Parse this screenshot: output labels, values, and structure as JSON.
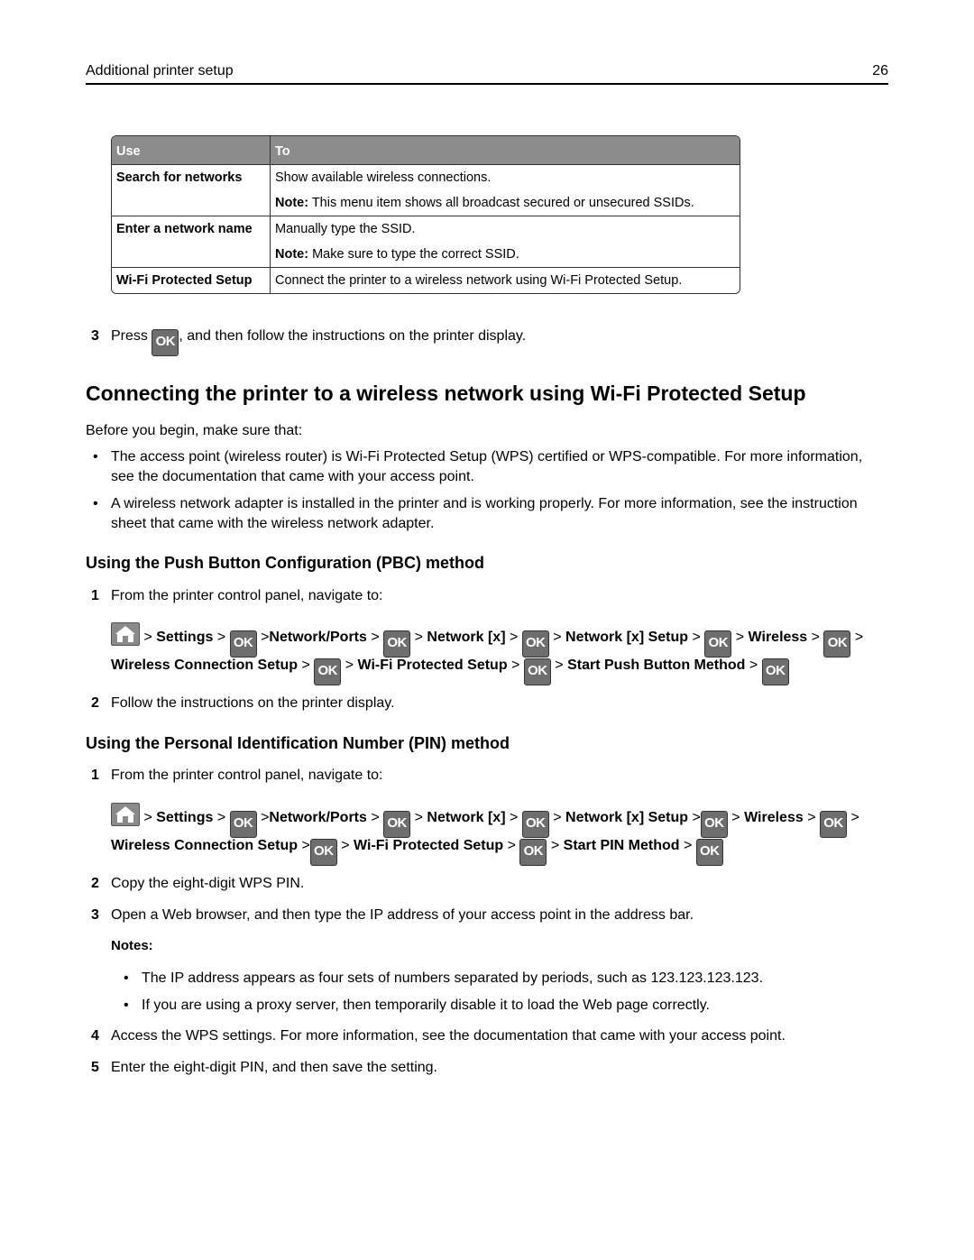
{
  "header": {
    "section": "Additional printer setup",
    "page_number": "26"
  },
  "table": {
    "columns": [
      "Use",
      "To"
    ],
    "rows": [
      {
        "use": "Search for networks",
        "lines": [
          {
            "label": "",
            "text": "Show available wireless connections."
          },
          {
            "label": "Note:",
            "text": " This menu item shows all broadcast secured or unsecured SSIDs."
          }
        ]
      },
      {
        "use": "Enter a network name",
        "lines": [
          {
            "label": "",
            "text": "Manually type the SSID."
          },
          {
            "label": "Note:",
            "text": " Make sure to type the correct SSID."
          }
        ]
      },
      {
        "use": "Wi-Fi Protected Setup",
        "lines": [
          {
            "label": "",
            "text": "Connect the printer to a wireless network using Wi-Fi Protected Setup."
          }
        ]
      }
    ]
  },
  "step3_top": {
    "number": "3",
    "before": "Press ",
    "button": "OK",
    "after": ", and then follow the instructions on the printer display."
  },
  "section": {
    "title": "Connecting the printer to a wireless network using Wi-Fi Protected Setup",
    "intro": "Before you begin, make sure that:",
    "bullets": [
      "The access point (wireless router) is Wi-Fi Protected Setup (WPS) certified or WPS-compatible. For more information, see the documentation that came with your access point.",
      "A wireless network adapter is installed in the printer and is working properly. For more information, see the instruction sheet that came with the wireless network adapter."
    ]
  },
  "pbc": {
    "title": "Using the Push Button Configuration (PBC) method",
    "step1": {
      "number": "1",
      "text": "From the printer control panel, navigate to:"
    },
    "path_line1": [
      "Settings",
      "Network/Ports",
      "Network [x]",
      "Network [x] Setup",
      "Wireless"
    ],
    "path_line2": [
      "Wireless Connection Setup",
      "Wi-Fi Protected Setup",
      "Start Push Button Method"
    ],
    "step2": {
      "number": "2",
      "text": "Follow the instructions on the printer display."
    }
  },
  "pin": {
    "title": "Using the Personal Identification Number (PIN) method",
    "step1": {
      "number": "1",
      "text": "From the printer control panel, navigate to:"
    },
    "path_line1": [
      "Settings",
      "Network/Ports",
      "Network [x]",
      "Network [x] Setup",
      "Wireless"
    ],
    "path_line2": [
      "Wireless Connection Setup",
      "Wi-Fi Protected Setup",
      "Start PIN Method"
    ],
    "step2": {
      "number": "2",
      "text": "Copy the eight-digit WPS PIN."
    },
    "step3": {
      "number": "3",
      "text": "Open a Web browser, and then type the IP address of your access point in the address bar."
    },
    "notes_label": "Notes:",
    "notes": [
      "The IP address appears as four sets of numbers separated by periods, such as 123.123.123.123.",
      "If you are using a proxy server, then temporarily disable it to load the Web page correctly."
    ],
    "step4": {
      "number": "4",
      "text": "Access the WPS settings. For more information, see the documentation that came with your access point."
    },
    "step5": {
      "number": "5",
      "text": "Enter the eight-digit PIN, and then save the setting."
    }
  },
  "icons": {
    "ok_button_label": "OK",
    "home_icon": "home-icon",
    "separator": ">",
    "bullet": "•"
  },
  "colors": {
    "table_header_bg": "#8c8c8c",
    "ok_button_bg": "#6e6e6e"
  }
}
